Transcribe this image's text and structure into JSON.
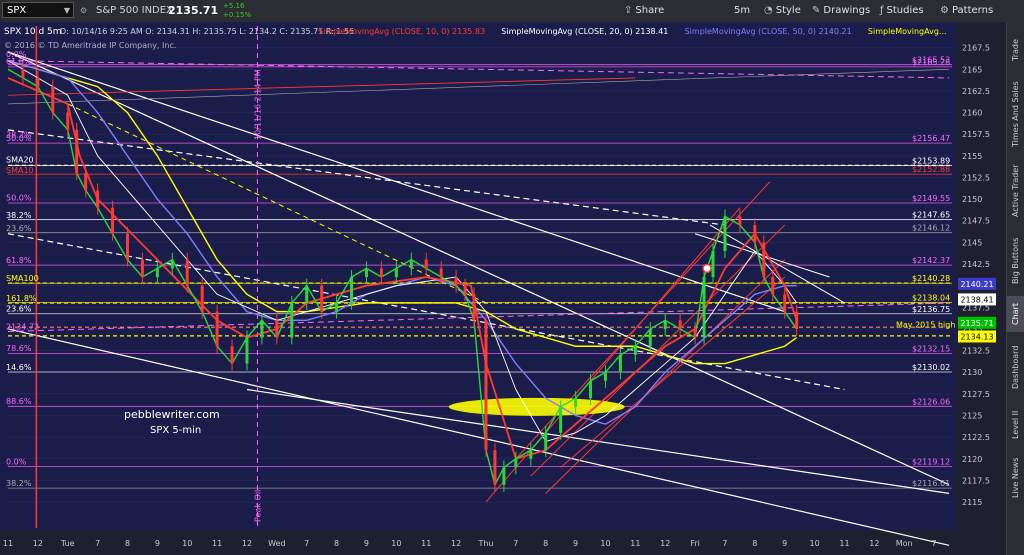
{
  "header": {
    "symbol": "SPX",
    "symbol_name": "S&P 500 INDEX",
    "last": "2135.71",
    "change": "+5.16",
    "change_pct": "+0.15%",
    "toolbar": [
      {
        "label": "Share",
        "icon": "share-icon"
      },
      {
        "label": "5m",
        "icon": "clock-icon"
      },
      {
        "label": "Style",
        "icon": "style-icon"
      },
      {
        "label": "Drawings",
        "icon": "pencil-icon"
      },
      {
        "label": "Studies",
        "icon": "studies-icon"
      },
      {
        "label": "Patterns",
        "icon": "patterns-icon"
      }
    ]
  },
  "sidebar_tabs": [
    "Trade",
    "Times And Sales",
    "Active Trader",
    "Big Buttons",
    "Chart",
    "Dashboard",
    "Level II",
    "Live News"
  ],
  "sidebar_active": "Chart",
  "chart_data": {
    "type": "line",
    "title": "SPX 10 d 5m",
    "ohlc_text": "D: 10/14/16 9:25 AM   O: 2134.31   H: 2135.75   L: 2134.2   C: 2135.71   R: 1.55",
    "studies": [
      {
        "label": "SimpleMovingAvg (CLOSE, 10, 0)",
        "value": "2135.83",
        "color": "#ff3b30"
      },
      {
        "label": "SimpleMovingAvg (CLOSE, 20, 0)",
        "value": "2138.41",
        "color": "#ffffff"
      },
      {
        "label": "SimpleMovingAvg (CLOSE, 50, 0)",
        "value": "2140.21",
        "color": "#7f7fff"
      },
      {
        "label": "SimpleMovingAvg...",
        "value": "",
        "color": "#ffff00"
      }
    ],
    "copyright": "© 2016 © TD Ameritrade IP Company, Inc.",
    "watermark": "pebblewriter.com",
    "watermark2": "SPX 5-min",
    "ylim": [
      2112,
      2170
    ],
    "y_ticks": [
      2115,
      2117.5,
      2120,
      2122.5,
      2125,
      2127.5,
      2130,
      2132.5,
      2135,
      2137.5,
      2140,
      2142.5,
      2145,
      2147.5,
      2150,
      2152.5,
      2155,
      2157.5,
      2160,
      2162.5,
      2165,
      2167.5
    ],
    "x_ticks": [
      {
        "label": "11",
        "x": 0
      },
      {
        "label": "12",
        "x": 1
      },
      {
        "label": "Tue",
        "x": 2
      },
      {
        "label": "7",
        "x": 3
      },
      {
        "label": "8",
        "x": 4
      },
      {
        "label": "9",
        "x": 5
      },
      {
        "label": "10",
        "x": 6
      },
      {
        "label": "11",
        "x": 7
      },
      {
        "label": "12",
        "x": 8
      },
      {
        "label": "Wed",
        "x": 9
      },
      {
        "label": "7",
        "x": 10
      },
      {
        "label": "8",
        "x": 11
      },
      {
        "label": "9",
        "x": 12
      },
      {
        "label": "10",
        "x": 13
      },
      {
        "label": "11",
        "x": 14
      },
      {
        "label": "12",
        "x": 15
      },
      {
        "label": "Thu",
        "x": 16
      },
      {
        "label": "7",
        "x": 17
      },
      {
        "label": "8",
        "x": 18
      },
      {
        "label": "9",
        "x": 19
      },
      {
        "label": "10",
        "x": 20
      },
      {
        "label": "11",
        "x": 21
      },
      {
        "label": "12",
        "x": 22
      },
      {
        "label": "Fri",
        "x": 23
      },
      {
        "label": "7",
        "x": 24
      },
      {
        "label": "8",
        "x": 25
      },
      {
        "label": "9",
        "x": 26
      },
      {
        "label": "10",
        "x": 27
      },
      {
        "label": "11",
        "x": 28
      },
      {
        "label": "12",
        "x": 29
      },
      {
        "label": "Mon",
        "x": 30
      },
      {
        "label": "7",
        "x": 31
      }
    ],
    "x_max": 31.6,
    "price_tags": [
      {
        "label": "2165.53",
        "y": 2165.53,
        "color": "#ff66ff"
      },
      {
        "label": "2165.28",
        "y": 2165.28,
        "color": "#ff66ff"
      },
      {
        "label": "2156.47",
        "y": 2156.47,
        "color": "#ff66ff"
      },
      {
        "label": "2153.89",
        "y": 2153.89,
        "color": "#ffffff"
      },
      {
        "label": "2152.88",
        "y": 2152.88,
        "color": "#ff3b30"
      },
      {
        "label": "2149.55",
        "y": 2149.55,
        "color": "#ff66ff"
      },
      {
        "label": "2147.65",
        "y": 2147.65,
        "color": "#ffffff"
      },
      {
        "label": "2146.12",
        "y": 2146.12,
        "color": "#aaaaaa"
      },
      {
        "label": "2142.37",
        "y": 2142.37,
        "color": "#ff66ff"
      },
      {
        "label": "2140.28",
        "y": 2140.28,
        "color": "#ffff00"
      },
      {
        "label": "2138.04",
        "y": 2138.04,
        "color": "#ffff00"
      },
      {
        "label": "2136.75",
        "y": 2136.75,
        "color": "#ffffff"
      },
      {
        "label": "2132.15",
        "y": 2132.15,
        "color": "#ff66ff"
      },
      {
        "label": "2130.02",
        "y": 2130.02,
        "color": "#ffffff"
      },
      {
        "label": "2126.06",
        "y": 2126.06,
        "color": "#ff66ff"
      },
      {
        "label": "2119.12",
        "y": 2119.12,
        "color": "#ff66ff"
      },
      {
        "label": "2116.61",
        "y": 2116.61,
        "color": "#aaaaaa"
      }
    ],
    "axis_badges": [
      {
        "label": "2140.21",
        "y": 2140.21,
        "bg": "#3c3cc8",
        "fg": "#ffffff"
      },
      {
        "label": "2138.41",
        "y": 2138.41,
        "bg": "#ffffff",
        "fg": "#000000"
      },
      {
        "label": "2135.71",
        "y": 2135.71,
        "bg": "#00c000",
        "fg": "#ffffff"
      },
      {
        "label": "2134.13",
        "y": 2134.13,
        "bg": "#ffff00",
        "fg": "#000000"
      }
    ],
    "left_levels": [
      {
        "label": "0.0%",
        "y": 2166.2,
        "color": "#ff66ff"
      },
      {
        "label": "61.8%",
        "y": 2165.4,
        "color": "#ff66ff"
      },
      {
        "label": "50.0%",
        "y": 2156.5,
        "color": "#ff66ff"
      },
      {
        "label": "38.2%",
        "y": 2156.9,
        "color": "#ff66ff"
      },
      {
        "label": "SMA20",
        "y": 2154.0,
        "color": "#ffffff"
      },
      {
        "label": "SMA10",
        "y": 2152.8,
        "color": "#ff3b30"
      },
      {
        "label": "50.0%",
        "y": 2149.6,
        "color": "#ff66ff"
      },
      {
        "label": "38.2%",
        "y": 2147.6,
        "color": "#ffffff"
      },
      {
        "label": "23.6%",
        "y": 2146.1,
        "color": "#aaaaaa"
      },
      {
        "label": "61.8%",
        "y": 2142.4,
        "color": "#ff66ff"
      },
      {
        "label": "SMA100",
        "y": 2140.3,
        "color": "#ffff00"
      },
      {
        "label": "161.8%",
        "y": 2138.0,
        "color": "#ffff00"
      },
      {
        "label": "23.6%",
        "y": 2136.8,
        "color": "#ffffff"
      },
      {
        "label": "2134.72",
        "y": 2134.72,
        "color": "#ff66ff"
      },
      {
        "label": "78.6%",
        "y": 2132.2,
        "color": "#ff66ff"
      },
      {
        "label": "14.6%",
        "y": 2130.0,
        "color": "#ffffff"
      },
      {
        "label": "88.6%",
        "y": 2126.1,
        "color": "#ff66ff"
      },
      {
        "label": "0.0%",
        "y": 2119.1,
        "color": "#ff66ff"
      },
      {
        "label": "38.2%",
        "y": 2116.6,
        "color": "#aaaaaa"
      }
    ],
    "annotations": [
      {
        "label": "10/11/16 2:14 PM",
        "x": 8.35
      },
      {
        "label": "Peak Oil",
        "x": 8.35
      }
    ],
    "may_high_label": "May 2015 high",
    "price_series": {
      "x": [
        0,
        0.5,
        1,
        1.5,
        2,
        2.3,
        2.6,
        3,
        3.5,
        4,
        4.5,
        5,
        5.5,
        6,
        6.5,
        7,
        7.5,
        8,
        8.5,
        9,
        9.5,
        10,
        10.5,
        11,
        11.5,
        12,
        12.5,
        13,
        13.5,
        14,
        14.5,
        15,
        15.3,
        15.6,
        16,
        16.3,
        16.6,
        17,
        17.5,
        18,
        18.5,
        19,
        19.5,
        20,
        20.5,
        21,
        21.5,
        22,
        22.5,
        23,
        23.3,
        23.6,
        24,
        24.5,
        25,
        25.3,
        25.6,
        26,
        26.4
      ],
      "y": [
        2165,
        2164,
        2163,
        2160,
        2158,
        2153,
        2151,
        2149,
        2146,
        2143,
        2141,
        2142,
        2143,
        2140,
        2137,
        2133,
        2131,
        2134,
        2136,
        2134,
        2138,
        2140,
        2137,
        2138,
        2141,
        2142,
        2141,
        2142,
        2143,
        2142,
        2141,
        2140,
        2139,
        2136,
        2121,
        2117,
        2119,
        2120,
        2121,
        2123,
        2126,
        2127,
        2129,
        2130,
        2132,
        2133,
        2135,
        2136,
        2135,
        2134,
        2141,
        2144,
        2148,
        2147,
        2145,
        2141,
        2139,
        2137,
        2135
      ]
    },
    "sma10": {
      "x": [
        0,
        2,
        2.4,
        3,
        5,
        7,
        8,
        9,
        10,
        12,
        14,
        15.5,
        16,
        17,
        18,
        19,
        20,
        21,
        22,
        23,
        24,
        25,
        26,
        26.4
      ],
      "y": [
        2164,
        2161,
        2155,
        2150,
        2143,
        2136,
        2134,
        2135,
        2138,
        2140,
        2141,
        2140,
        2131,
        2120,
        2121,
        2124,
        2127,
        2130,
        2133,
        2135,
        2142,
        2146,
        2140,
        2136
      ]
    },
    "sma20": {
      "x": [
        0,
        2,
        3,
        5,
        7,
        9,
        11,
        13,
        15,
        16,
        17,
        18,
        19,
        20,
        21,
        22,
        23,
        24,
        25,
        26,
        26.4
      ],
      "y": [
        2166,
        2162,
        2155,
        2147,
        2139,
        2136,
        2138,
        2140,
        2141,
        2137,
        2128,
        2122,
        2123,
        2125,
        2128,
        2131,
        2134,
        2139,
        2144,
        2140,
        2138
      ]
    },
    "sma50": {
      "x": [
        0,
        2,
        3,
        4,
        5,
        6,
        7,
        8,
        9,
        10,
        11,
        12,
        13,
        14,
        15,
        16,
        17,
        18,
        19,
        20,
        21,
        22,
        23,
        24,
        25,
        26,
        26.4
      ],
      "y": [
        2166,
        2164,
        2160,
        2155,
        2150,
        2146,
        2141,
        2137,
        2136,
        2136,
        2137,
        2139,
        2140,
        2141,
        2140,
        2136,
        2131,
        2127,
        2125,
        2124,
        2126,
        2130,
        2133,
        2136,
        2139,
        2140,
        2140
      ]
    },
    "sma100": {
      "x": [
        0,
        2,
        3,
        4,
        5,
        6,
        7,
        8,
        9,
        10,
        12,
        14,
        15,
        16,
        17,
        18,
        19,
        20,
        21,
        22,
        23,
        24,
        25,
        26,
        26.4
      ],
      "y": [
        2166,
        2164,
        2163,
        2160,
        2155,
        2149,
        2143,
        2139,
        2137,
        2137,
        2138,
        2138,
        2138,
        2137,
        2135,
        2134,
        2133,
        2133,
        2133,
        2132,
        2131,
        2131,
        2132,
        2133,
        2134
      ]
    }
  }
}
